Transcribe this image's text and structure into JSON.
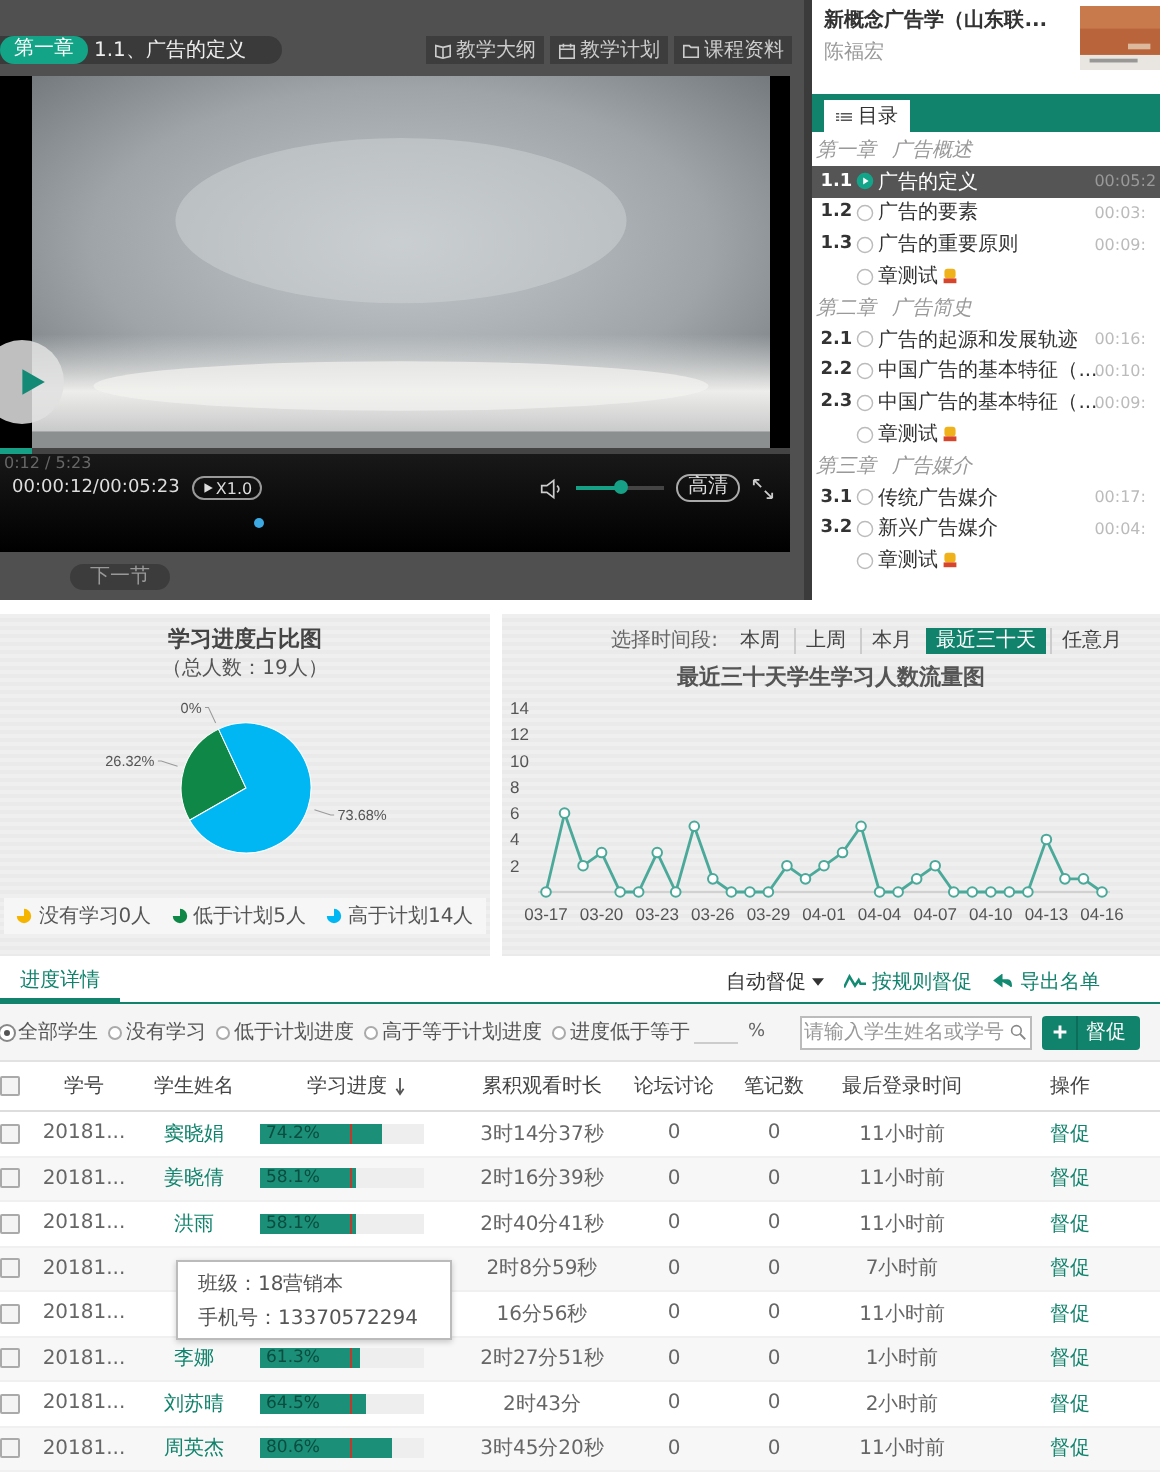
{
  "player": {
    "chapter_badge": "第一章",
    "lesson_title": "1.1、广告的定义",
    "tools": [
      "教学大纲",
      "教学计划",
      "课程资料"
    ],
    "progress": {
      "level": 0.04
    },
    "time_small": "0:12 / 5:23",
    "time": "00:00:12/00:05:23",
    "speed": "X1.0",
    "volume": {
      "level": 0.5
    },
    "quality": "高清",
    "next_button": "下一节"
  },
  "course": {
    "title": "新概念广告学（山东联...",
    "teacher": "陈福宏",
    "tab": {
      "label": "目录",
      "selected": true
    },
    "items": [
      {
        "kind": "chapter",
        "number": "第一章",
        "title": "广告概述"
      },
      {
        "kind": "lesson",
        "number": "1.1",
        "title": "广告的定义",
        "duration": "00:05:2",
        "selected": true
      },
      {
        "kind": "lesson",
        "number": "1.2",
        "title": "广告的要素",
        "duration": "00:03:",
        "selected": false
      },
      {
        "kind": "lesson",
        "number": "1.3",
        "title": "广告的重要原则",
        "duration": "00:09:",
        "selected": false
      },
      {
        "kind": "quiz",
        "title": "章测试"
      },
      {
        "kind": "chapter",
        "number": "第二章",
        "title": "广告简史"
      },
      {
        "kind": "lesson",
        "number": "2.1",
        "title": "广告的起源和发展轨迹",
        "duration": "00:16:",
        "selected": false
      },
      {
        "kind": "lesson",
        "number": "2.2",
        "title": "中国广告的基本特征（...",
        "duration": "00:10:",
        "selected": false
      },
      {
        "kind": "lesson",
        "number": "2.3",
        "title": "中国广告的基本特征（...",
        "duration": "00:09:",
        "selected": false
      },
      {
        "kind": "quiz",
        "title": "章测试"
      },
      {
        "kind": "chapter",
        "number": "第三章",
        "title": "广告媒介"
      },
      {
        "kind": "lesson",
        "number": "3.1",
        "title": "传统广告媒介",
        "duration": "00:17:",
        "selected": false
      },
      {
        "kind": "lesson",
        "number": "3.2",
        "title": "新兴广告媒介",
        "duration": "00:04:",
        "selected": false
      },
      {
        "kind": "quiz",
        "title": "章测试"
      }
    ]
  },
  "stats": {
    "pie": {
      "subtitle": "（总人数：19人）",
      "chart_data": {
        "type": "pie",
        "title": "学习进度占比图",
        "categories": [
          "没有学习0人",
          "低于计划5人",
          "高于计划14人"
        ],
        "series": [
          {
            "values": [
              0,
              26.32,
              73.68
            ]
          }
        ],
        "colors": [
          "#f5b400",
          "#0e8747",
          "#00b7f3"
        ],
        "value_labels": [
          "0%",
          "26.32%",
          "73.68%"
        ]
      }
    },
    "period_label": "选择时间段:",
    "periods": [
      {
        "label": "本周",
        "selected": false
      },
      {
        "label": "上周",
        "selected": false
      },
      {
        "label": "本月",
        "selected": false
      },
      {
        "label": "最近三十天",
        "selected": true
      },
      {
        "label": "任意月",
        "selected": false
      }
    ],
    "line": {
      "chart_data": {
        "type": "line",
        "title": "最近三十天学生学习人数流量图",
        "categories": [
          "03-17",
          null,
          null,
          "03-20",
          null,
          null,
          "03-23",
          null,
          null,
          "03-26",
          null,
          null,
          "03-29",
          null,
          null,
          "04-01",
          null,
          null,
          "04-04",
          null,
          null,
          "04-07",
          null,
          null,
          "04-10",
          null,
          null,
          "04-13",
          null,
          null,
          "04-16"
        ],
        "series": [
          {
            "color": "#4ba99a",
            "marker": "circle",
            "values": [
              0,
              6,
              2,
              3,
              0,
              0,
              3,
              0,
              5,
              1,
              0,
              0,
              0,
              2,
              1,
              2,
              3,
              5,
              0,
              0,
              1,
              2,
              0,
              0,
              0,
              0,
              0,
              4,
              1,
              1,
              0
            ]
          }
        ],
        "ylim": [
          0,
          14
        ],
        "yticks": [
          2,
          4,
          6,
          8,
          10,
          12,
          14
        ]
      }
    }
  },
  "details": {
    "tabs": [
      {
        "label": "进度详情",
        "selected": true
      }
    ],
    "actions": [
      "自动督促",
      "按规则督促",
      "导出名单"
    ],
    "filters": [
      {
        "label": "全部学生",
        "selected": true
      },
      {
        "label": "没有学习",
        "selected": false
      },
      {
        "label": "低于计划进度",
        "selected": false
      },
      {
        "label": "高于等于计划进度",
        "selected": false
      },
      {
        "label": "进度低于等于",
        "selected": false
      }
    ],
    "percent_sign": "%",
    "search": {
      "placeholder": "请输入学生姓名或学号"
    },
    "urge_button": "督促",
    "select_all": {
      "checked": false
    },
    "columns": [
      "学号",
      "学生姓名",
      "学习进度",
      "累积观看时长",
      "论坛讨论",
      "笔记数",
      "最后登录时间",
      "操作"
    ],
    "rows": [
      {
        "checked": false,
        "id": "20181...",
        "name": "窦晓娟",
        "progress": "74.2%",
        "level": 0.742,
        "watch_time": "3时14分37秒",
        "forum": "0",
        "notes": "0",
        "last_login": "11小时前",
        "action": "督促"
      },
      {
        "checked": false,
        "id": "20181...",
        "name": "姜晓倩",
        "progress": "58.1%",
        "level": 0.581,
        "watch_time": "2时16分39秒",
        "forum": "0",
        "notes": "0",
        "last_login": "11小时前",
        "action": "督促"
      },
      {
        "checked": false,
        "id": "20181...",
        "name": "洪雨",
        "progress": "58.1%",
        "level": 0.581,
        "watch_time": "2时40分41秒",
        "forum": "0",
        "notes": "0",
        "last_login": "11小时前",
        "action": "督促"
      },
      {
        "checked": false,
        "id": "20181...",
        "watch_time": "2时8分59秒",
        "forum": "0",
        "notes": "0",
        "last_login": "7小时前",
        "action": "督促"
      },
      {
        "checked": false,
        "id": "20181...",
        "watch_time": "16分56秒",
        "forum": "0",
        "notes": "0",
        "last_login": "11小时前",
        "action": "督促"
      },
      {
        "checked": false,
        "id": "20181...",
        "name": "李娜",
        "progress": "61.3%",
        "level": 0.613,
        "watch_time": "2时27分51秒",
        "forum": "0",
        "notes": "0",
        "last_login": "1小时前",
        "action": "督促"
      },
      {
        "checked": false,
        "id": "20181...",
        "name": "刘苏晴",
        "progress": "64.5%",
        "level": 0.645,
        "watch_time": "2时43分",
        "forum": "0",
        "notes": "0",
        "last_login": "2小时前",
        "action": "督促"
      },
      {
        "checked": false,
        "id": "20181...",
        "name": "周英杰",
        "progress": "80.6%",
        "level": 0.806,
        "watch_time": "3时45分20秒",
        "forum": "0",
        "notes": "0",
        "last_login": "11小时前",
        "action": "督促"
      }
    ],
    "tooltip": {
      "lines": [
        "班级：18营销本",
        "手机号：13370572294"
      ]
    }
  }
}
